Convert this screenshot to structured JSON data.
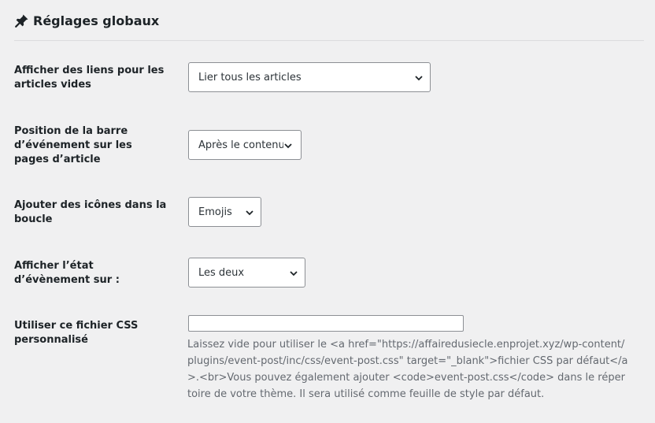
{
  "section": {
    "icon": "pushpin-icon",
    "title": "Réglages globaux"
  },
  "settings": [
    {
      "label": "Afficher des liens pour les articles vides",
      "value": "Lier tous les articles"
    },
    {
      "label": "Position de la barre d’événement sur les pages d’article",
      "value": "Après le contenu"
    },
    {
      "label": "Ajouter des icônes dans la boucle",
      "value": "Emojis"
    },
    {
      "label": "Afficher l’état d’évènement sur :",
      "value": "Les deux"
    },
    {
      "label": "Utiliser ce fichier CSS personnalisé",
      "input_value": "",
      "help": "Laissez vide pour utiliser le <a href=\"https://affairedusiecle.enprojet.xyz/wp-content/plugins/event-post/inc/css/event-post.css\" target=\"_blank\">fichier CSS par défaut</a>.<br>Vous pouvez également ajouter <code>event-post.css</code> dans le répertoire de votre thème. Il sera utilisé comme feuille de style par défaut."
    }
  ],
  "colors": {
    "background": "#f0f0f1",
    "text": "#1d2327",
    "help_text": "#646970",
    "border": "#8c8f94"
  }
}
